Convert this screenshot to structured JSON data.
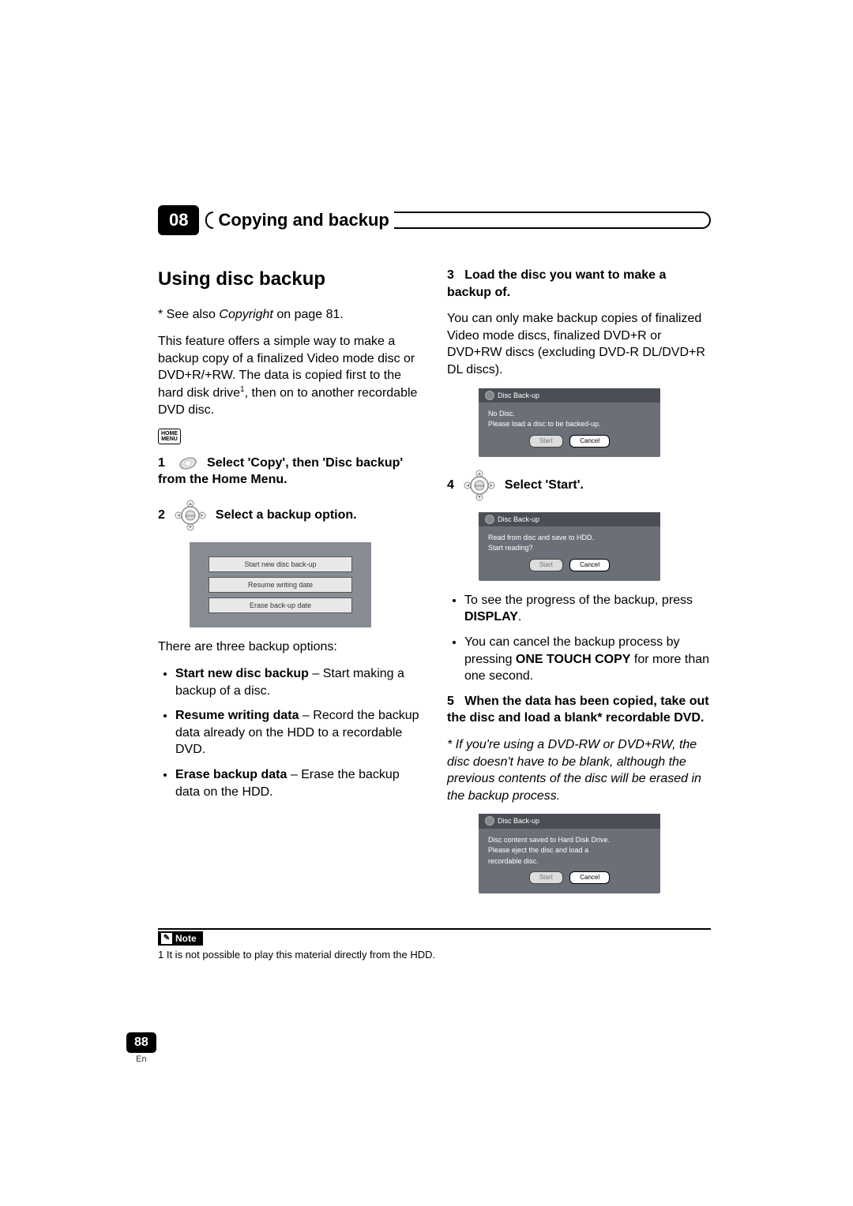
{
  "chapter": {
    "num": "08",
    "title": "Copying and backup"
  },
  "left": {
    "section_title": "Using disc backup",
    "see_also_prefix": "* See also ",
    "see_also_italic": "Copyright",
    "see_also_suffix": " on page 81.",
    "intro_a": "This feature offers a simple way to make a backup copy of a finalized Video mode disc or DVD+R/+RW. The data is copied first to the hard disk drive",
    "intro_sup": "1",
    "intro_b": ", then on to another recordable DVD disc.",
    "home_menu_icon": "HOME\nMENU",
    "step1": {
      "num": "1",
      "text_a": "Select 'Copy', then 'Disc backup' from the Home Menu."
    },
    "step2": {
      "num": "2",
      "text": "Select a backup option."
    },
    "menu": {
      "item1": "Start new disc back-up",
      "item2": "Resume writing date",
      "item3": "Erase back-up date"
    },
    "options_intro": "There are three backup options:",
    "opt1_b": "Start new disc backup",
    "opt1_r": " – Start making a backup of a disc.",
    "opt2_b": "Resume writing data",
    "opt2_r": " – Record the backup data already on the HDD to a recordable DVD.",
    "opt3_b": "Erase backup data",
    "opt3_r": " – Erase the backup data on the HDD."
  },
  "right": {
    "step3_num": "3",
    "step3_text": "Load the disc you want to make a backup of.",
    "step3_body": "You can only make backup copies of finalized Video mode discs, finalized DVD+R or  DVD+RW discs (excluding DVD-R DL/DVD+R DL discs).",
    "panel1": {
      "title": "Disc Back-up",
      "line1": "No Disc.",
      "line2": "Please load a disc to be backed-up.",
      "start": "Start",
      "cancel": "Cancel"
    },
    "step4_num": "4",
    "step4_text": "Select 'Start'.",
    "panel2": {
      "title": "Disc Back-up",
      "line1": "Read from disc and save to HDD.",
      "line2": "Start reading?",
      "start": "Start",
      "cancel": "Cancel"
    },
    "bullet1_a": "To see the progress of the backup, press ",
    "bullet1_b": "DISPLAY",
    "bullet1_c": ".",
    "bullet2_a": "You can cancel the backup process by pressing ",
    "bullet2_b": "ONE TOUCH COPY",
    "bullet2_c": " for more than one second.",
    "step5_num": "5",
    "step5_text": "When the data has been copied, take out the disc and load a blank* recordable DVD.",
    "step5_note": "* If you're using a DVD-RW or DVD+RW, the disc doesn't have to be blank, although the previous contents of the disc will be erased in the backup process.",
    "panel3": {
      "title": "Disc Back-up",
      "line1": "Disc content saved to Hard Disk Drive.",
      "line2": "Please eject the disc and load a",
      "line3": "recordable disc.",
      "start": "Start",
      "cancel": "Cancel"
    }
  },
  "note": {
    "label": "Note",
    "footnote": "1 It is not possible to play this material directly from the HDD."
  },
  "footer": {
    "page": "88",
    "lang": "En"
  }
}
